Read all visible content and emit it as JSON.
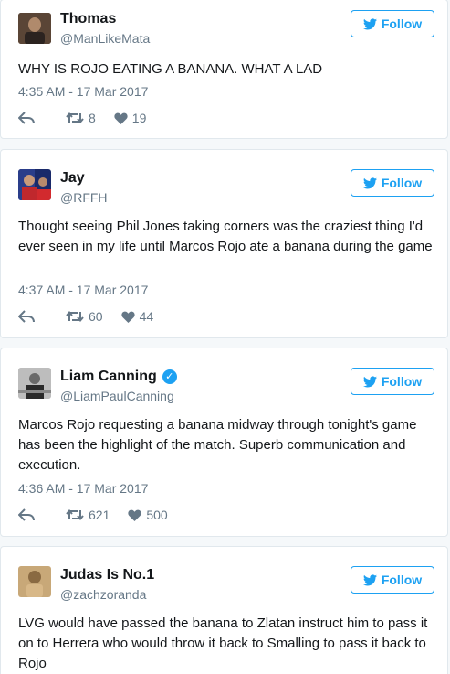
{
  "follow_label": "Follow",
  "icons": {
    "follow": "twitter-bird-icon",
    "reply": "reply-icon",
    "retweet": "retweet-icon",
    "like": "heart-icon",
    "verified": "verified-badge-icon"
  },
  "colors": {
    "accent": "#1da1f2",
    "muted": "#657786",
    "text": "#14171a"
  },
  "tweets": [
    {
      "name": "Thomas",
      "handle": "@ManLikeMata",
      "verified": false,
      "text": "WHY IS ROJO EATING A BANANA. WHAT A LAD",
      "time": "4:35 AM - 17 Mar 2017",
      "retweets": "8",
      "likes": "19"
    },
    {
      "name": "Jay",
      "handle": "@RFFH",
      "verified": false,
      "text": "Thought seeing Phil Jones taking corners was the craziest thing I'd ever seen in my life until Marcos Rojo ate a banana during the game",
      "time": "4:37 AM - 17 Mar 2017",
      "retweets": "60",
      "likes": "44"
    },
    {
      "name": "Liam Canning",
      "handle": "@LiamPaulCanning",
      "verified": true,
      "text": "Marcos Rojo requesting a banana midway through tonight's game has been the highlight of the match. Superb communication and execution.",
      "time": "4:36 AM - 17 Mar 2017",
      "retweets": "621",
      "likes": "500"
    },
    {
      "name": "Judas Is No.1",
      "handle": "@zachzoranda",
      "verified": false,
      "text": "LVG would have passed the banana to Zlatan instruct him to pass it on to Herrera who would throw it back to Smalling to pass it back to Rojo"
    }
  ]
}
